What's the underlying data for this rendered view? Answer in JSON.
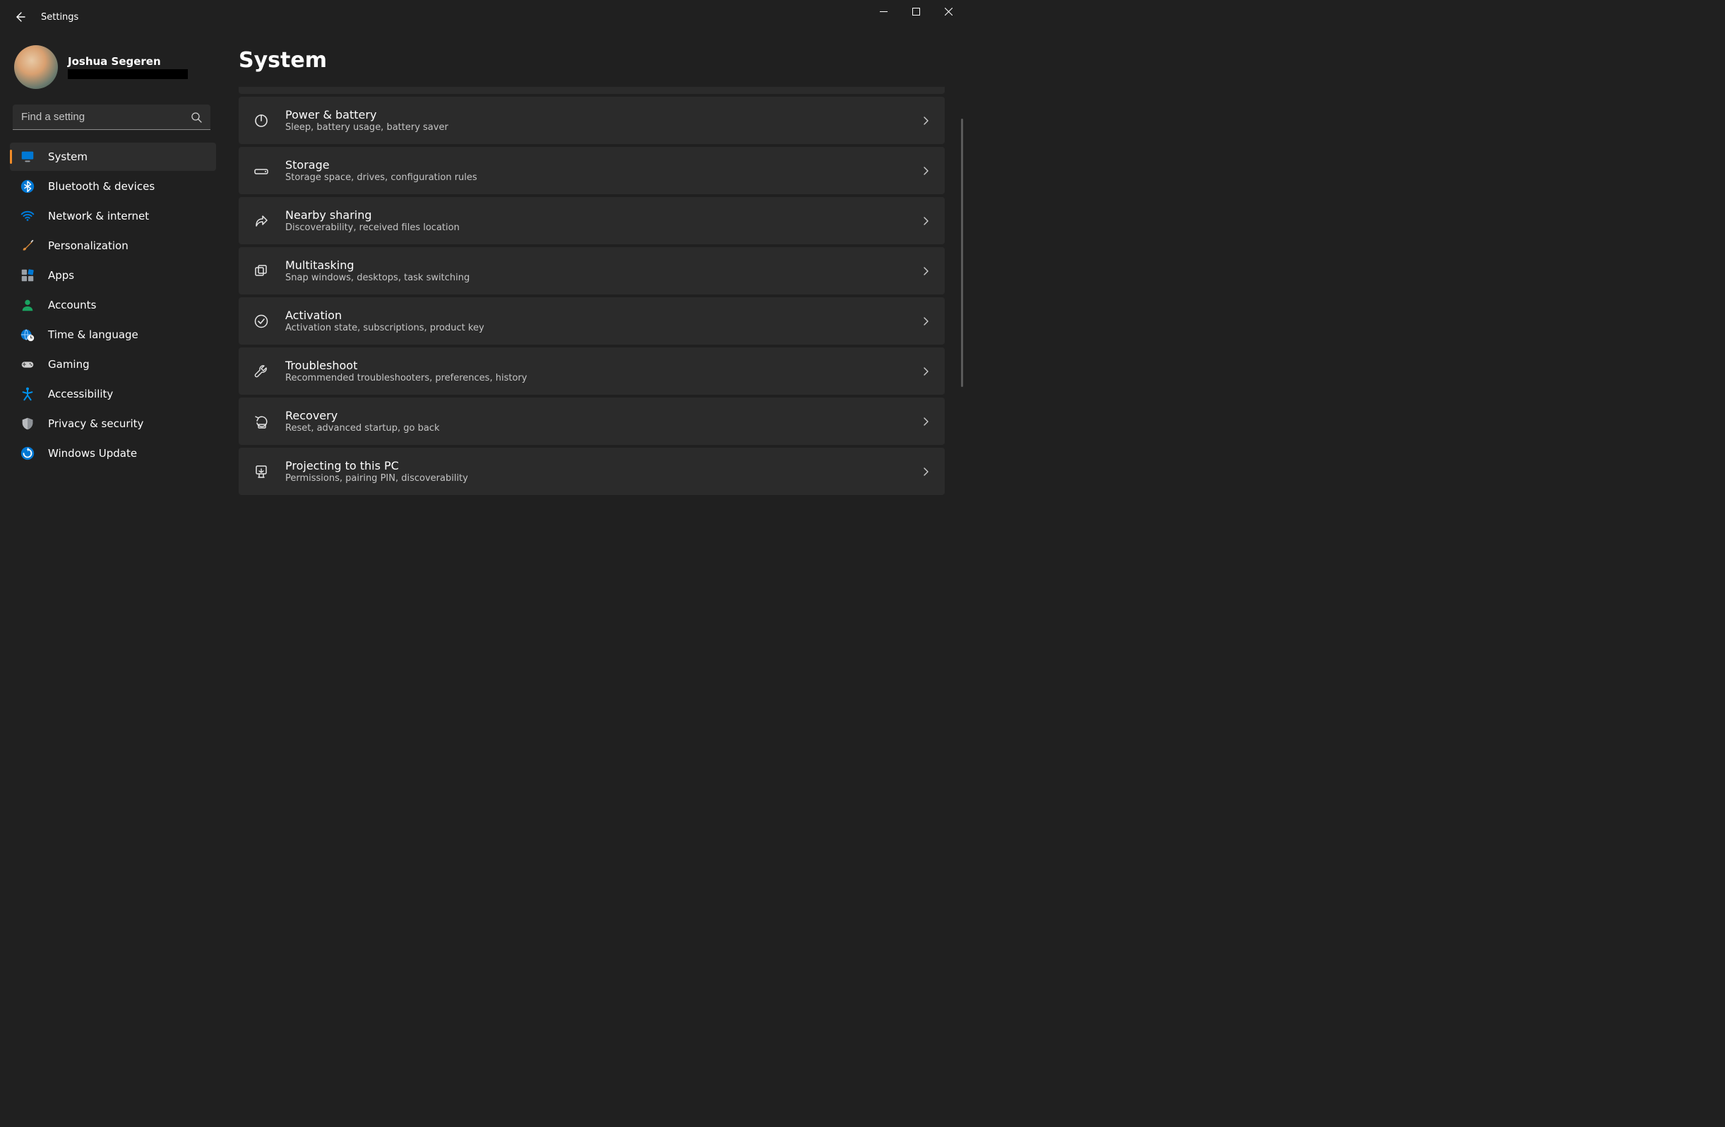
{
  "app_title": "Settings",
  "profile": {
    "name": "Joshua Segeren"
  },
  "search": {
    "placeholder": "Find a setting"
  },
  "nav": [
    {
      "icon": "monitor",
      "label": "System",
      "active": true
    },
    {
      "icon": "bluetooth",
      "label": "Bluetooth & devices"
    },
    {
      "icon": "wifi",
      "label": "Network & internet"
    },
    {
      "icon": "brush",
      "label": "Personalization"
    },
    {
      "icon": "apps",
      "label": "Apps"
    },
    {
      "icon": "person",
      "label": "Accounts"
    },
    {
      "icon": "globe-clock",
      "label": "Time & language"
    },
    {
      "icon": "gamepad",
      "label": "Gaming"
    },
    {
      "icon": "accessibility",
      "label": "Accessibility"
    },
    {
      "icon": "shield",
      "label": "Privacy & security"
    },
    {
      "icon": "update",
      "label": "Windows Update"
    }
  ],
  "page": {
    "title": "System"
  },
  "cards": [
    {
      "icon": "power",
      "title": "Power & battery",
      "sub": "Sleep, battery usage, battery saver"
    },
    {
      "icon": "drive",
      "title": "Storage",
      "sub": "Storage space, drives, configuration rules"
    },
    {
      "icon": "share",
      "title": "Nearby sharing",
      "sub": "Discoverability, received files location"
    },
    {
      "icon": "multitask",
      "title": "Multitasking",
      "sub": "Snap windows, desktops, task switching"
    },
    {
      "icon": "check-circle",
      "title": "Activation",
      "sub": "Activation state, subscriptions, product key"
    },
    {
      "icon": "wrench",
      "title": "Troubleshoot",
      "sub": "Recommended troubleshooters, preferences, history"
    },
    {
      "icon": "recovery",
      "title": "Recovery",
      "sub": "Reset, advanced startup, go back"
    },
    {
      "icon": "project",
      "title": "Projecting to this PC",
      "sub": "Permissions, pairing PIN, discoverability"
    }
  ]
}
